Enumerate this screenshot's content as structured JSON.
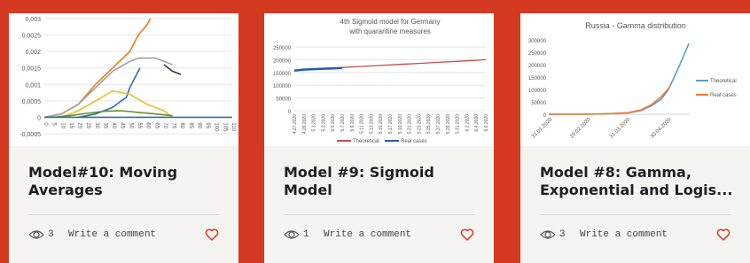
{
  "theme": {
    "background": "#d43a22",
    "card": "#f5f4f1",
    "heart": "#d43a22"
  },
  "cards": [
    {
      "title": "Model#10: Moving Averages",
      "views": "3",
      "comment_label": "Write a comment",
      "chart_data": {
        "type": "line",
        "y_ticks": [
          "0,003",
          "0,0025",
          "0,002",
          "0,0015",
          "0,001",
          "0,0005",
          "0",
          "-0,0005"
        ],
        "x_ticks": [
          "0",
          "5",
          "10",
          "15",
          "20",
          "25",
          "30",
          "35",
          "40",
          "45",
          "50",
          "55",
          "60",
          "65",
          "70",
          "75",
          "80",
          "85",
          "90",
          "95",
          "100",
          "105",
          "110"
        ],
        "ylim": [
          -0.0005,
          0.003
        ],
        "series": [
          {
            "color": "#e67e22",
            "x": [
              0,
              10,
              20,
              30,
              40,
              50,
              55,
              60,
              62
            ],
            "y": [
              0,
              0.0001,
              0.0004,
              0.001,
              0.0015,
              0.002,
              0.0025,
              0.0028,
              0.003
            ]
          },
          {
            "color": "#a0a0a0",
            "x": [
              0,
              10,
              20,
              30,
              40,
              50,
              55,
              60,
              65,
              70,
              75
            ],
            "y": [
              0,
              0.0001,
              0.0004,
              0.0009,
              0.0014,
              0.0017,
              0.0018,
              0.0018,
              0.0018,
              0.0017,
              0.0016
            ]
          },
          {
            "color": "#2c3e50",
            "x": [
              70,
              75,
              80
            ],
            "y": [
              0.0016,
              0.0014,
              0.0013
            ]
          },
          {
            "color": "#2e6da4",
            "x": [
              20,
              30,
              40,
              45,
              48,
              50,
              52,
              56
            ],
            "y": [
              0,
              0.0001,
              0.0003,
              0.0005,
              0.0006,
              0.0009,
              0.0011,
              0.0015
            ]
          },
          {
            "color": "#e6c229",
            "x": [
              10,
              20,
              30,
              40,
              50,
              60,
              70,
              75
            ],
            "y": [
              0,
              0.0002,
              0.0005,
              0.0008,
              0.0007,
              0.0004,
              0.0002,
              0
            ]
          },
          {
            "color": "#6b8e23",
            "x": [
              5,
              15,
              25,
              35,
              45,
              55,
              65,
              75
            ],
            "y": [
              0,
              5e-05,
              0.00012,
              0.00018,
              0.0002,
              0.00015,
              0.0001,
              5e-05
            ]
          },
          {
            "color": "#2e6da4",
            "x": [
              0,
              110
            ],
            "y": [
              0,
              0
            ]
          }
        ]
      }
    },
    {
      "title": "Model #9: Sigmoid Model",
      "views": "1",
      "comment_label": "Write a comment",
      "chart_data": {
        "type": "line",
        "title": "4th Sigmoid model for Germany with quarantine measures",
        "title_lines": [
          "4th Sigmoid model for Germany",
          "with quarantine measures"
        ],
        "y_ticks": [
          "250000",
          "200000",
          "150000",
          "100000",
          "50000",
          "0"
        ],
        "ylim": [
          0,
          250000
        ],
        "categories": [
          "4.27.2020",
          "4.29.2020",
          "5.1.2020",
          "5.3.2020",
          "5.5.2020",
          "5.7.2020",
          "5.9.2020",
          "5.11.2020",
          "5.13.2020",
          "5.15.2020",
          "5.17.2020",
          "5.19.2020",
          "5.21.2020",
          "5.23.2020",
          "5.25.2020",
          "5.27.2020",
          "5.29.2020",
          "5.31.2020",
          "6.2.2020",
          "6.4.2020",
          "6.6.2020"
        ],
        "series": [
          {
            "name": "Theoretical",
            "color": "#c0504d",
            "values": [
              158000,
              161000,
              163500,
              165500,
              167500,
              169500,
              171500,
              173500,
              175500,
              177500,
              179500,
              181500,
              183500,
              185500,
              187500,
              189500,
              191500,
              193500,
              195500,
              197500,
              200000
            ]
          },
          {
            "name": "Real cases",
            "color": "#1f5fa8",
            "values": [
              157000,
              161000,
              163000,
              164500,
              166000,
              167500
            ]
          }
        ],
        "legend": [
          "Theoretical",
          "Real cases"
        ]
      }
    },
    {
      "title": "Model #8: Gamma, Exponential and Logis...",
      "views": "3",
      "comment_label": "Write a comment",
      "chart_data": {
        "type": "line",
        "title": "Russia - Gamma distribution",
        "y_ticks": [
          "300000",
          "250000",
          "200000",
          "150000",
          "100000",
          "50000",
          "0"
        ],
        "ylim": [
          0,
          300000
        ],
        "x_ticks": [
          "31.01.2020",
          "29.02.2020",
          "31.03.2020",
          "30.04.2020"
        ],
        "series": [
          {
            "name": "Theoretical",
            "color": "#5b9bd5",
            "x": [
              0,
              29,
              45,
              60,
              70,
              78,
              85,
              90,
              95,
              100,
              106
            ],
            "y": [
              0,
              0,
              2000,
              5000,
              15000,
              35000,
              60000,
              95000,
              150000,
              210000,
              285000
            ]
          },
          {
            "name": "Real cases",
            "color": "#ed7d31",
            "x": [
              0,
              29,
              45,
              60,
              70,
              78,
              85,
              90,
              92
            ],
            "y": [
              0,
              0,
              2000,
              6000,
              18000,
              40000,
              70000,
              100000,
              114000
            ]
          }
        ],
        "legend": [
          "Theoretical",
          "Real cases"
        ]
      }
    }
  ]
}
